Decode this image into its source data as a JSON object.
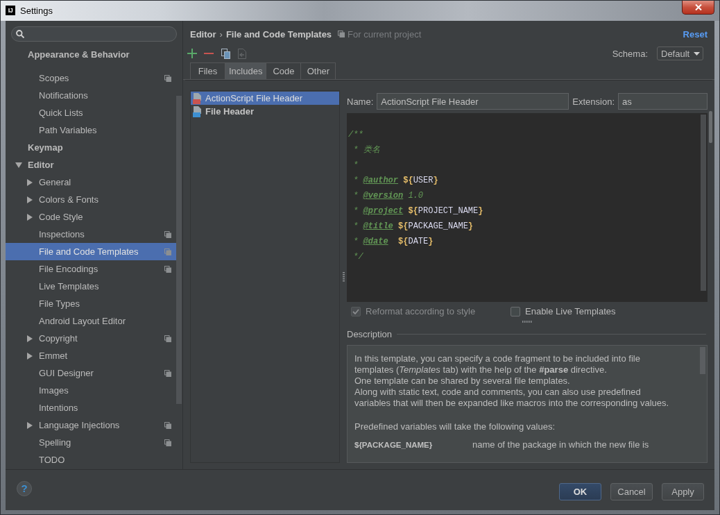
{
  "window": {
    "logo": "IJ",
    "title": "Settings"
  },
  "sidebar": {
    "tree": [
      {
        "label": "Appearance & Behavior",
        "selected": false,
        "per_project": false,
        "children": [
          {
            "label": "Scopes",
            "selected": false,
            "per_project": true
          },
          {
            "label": "Notifications",
            "selected": false,
            "per_project": false
          },
          {
            "label": "Quick Lists",
            "selected": false,
            "per_project": false
          },
          {
            "label": "Path Variables",
            "selected": false,
            "per_project": false
          }
        ]
      },
      {
        "label": "Keymap",
        "selected": false,
        "per_project": false
      },
      {
        "label": "Editor",
        "selected": false,
        "per_project": false,
        "expanded": true,
        "children": [
          {
            "label": "General",
            "selected": false,
            "per_project": false,
            "expanded": false
          },
          {
            "label": "Colors & Fonts",
            "selected": false,
            "per_project": false,
            "expanded": false
          },
          {
            "label": "Code Style",
            "selected": false,
            "per_project": false,
            "expanded": false
          },
          {
            "label": "Inspections",
            "selected": false,
            "per_project": true
          },
          {
            "label": "File and Code Templates",
            "selected": true,
            "per_project": true
          },
          {
            "label": "File Encodings",
            "selected": false,
            "per_project": true
          },
          {
            "label": "Live Templates",
            "selected": false,
            "per_project": false
          },
          {
            "label": "File Types",
            "selected": false,
            "per_project": false
          },
          {
            "label": "Android Layout Editor",
            "selected": false,
            "per_project": false
          },
          {
            "label": "Copyright",
            "selected": false,
            "per_project": true,
            "expanded": false
          },
          {
            "label": "Emmet",
            "selected": false,
            "per_project": false,
            "expanded": false
          },
          {
            "label": "GUI Designer",
            "selected": false,
            "per_project": true
          },
          {
            "label": "Images",
            "selected": false,
            "per_project": false
          },
          {
            "label": "Intentions",
            "selected": false,
            "per_project": false
          },
          {
            "label": "Language Injections",
            "selected": false,
            "per_project": true,
            "expanded": false
          },
          {
            "label": "Spelling",
            "selected": false,
            "per_project": true
          },
          {
            "label": "TODO",
            "selected": false,
            "per_project": false
          }
        ]
      }
    ]
  },
  "header": {
    "breadcrumb": [
      "Editor",
      "File and Code Templates"
    ],
    "separator": "›",
    "scope_note": "For current project",
    "reset": "Reset"
  },
  "toolbar": {
    "buttons": [
      {
        "kind": "add",
        "disabled": false
      },
      {
        "kind": "remove",
        "disabled": false
      },
      {
        "kind": "copy",
        "disabled": false
      },
      {
        "kind": "revert",
        "disabled": true
      }
    ],
    "schema_label": "Schema:",
    "schema_value": "Default"
  },
  "tabs": [
    {
      "label": "Files",
      "selected": false
    },
    {
      "label": "Includes",
      "selected": true
    },
    {
      "label": "Code",
      "selected": false
    },
    {
      "label": "Other",
      "selected": false
    }
  ],
  "templates": [
    {
      "name": "ActionScript File Header",
      "kind": "actionscript",
      "selected": true,
      "modified": false
    },
    {
      "name": "File Header",
      "kind": "java",
      "selected": false,
      "modified": true
    }
  ],
  "editor": {
    "name_label": "Name:",
    "name": "ActionScript File Header",
    "extension_label": "Extension:",
    "extension": "as",
    "code": [
      {
        "tokens": [
          {
            "kind": "comment",
            "text": "/**"
          }
        ]
      },
      {
        "tokens": [
          {
            "kind": "comment",
            "text": " * 类名"
          }
        ]
      },
      {
        "tokens": [
          {
            "kind": "comment",
            "text": " *"
          }
        ]
      },
      {
        "tokens": [
          {
            "kind": "comment",
            "text": " * "
          },
          {
            "kind": "tag",
            "text": "@author"
          },
          {
            "kind": "delim",
            "text": " ${"
          },
          {
            "kind": "var",
            "text": "USER"
          },
          {
            "kind": "delim",
            "text": "}"
          }
        ]
      },
      {
        "tokens": [
          {
            "kind": "comment",
            "text": " * "
          },
          {
            "kind": "tag",
            "text": "@version"
          },
          {
            "kind": "comment",
            "text": " 1.0"
          }
        ]
      },
      {
        "tokens": [
          {
            "kind": "comment",
            "text": " * "
          },
          {
            "kind": "tag",
            "text": "@project"
          },
          {
            "kind": "delim",
            "text": " ${"
          },
          {
            "kind": "var",
            "text": "PROJECT_NAME"
          },
          {
            "kind": "delim",
            "text": "}"
          }
        ]
      },
      {
        "tokens": [
          {
            "kind": "comment",
            "text": " * "
          },
          {
            "kind": "tag",
            "text": "@title"
          },
          {
            "kind": "delim",
            "text": " ${"
          },
          {
            "kind": "var",
            "text": "PACKAGE_NAME"
          },
          {
            "kind": "delim",
            "text": "}"
          }
        ]
      },
      {
        "tokens": [
          {
            "kind": "comment",
            "text": " * "
          },
          {
            "kind": "tag",
            "text": "@date"
          },
          {
            "kind": "delim",
            "text": "  ${"
          },
          {
            "kind": "var",
            "text": "DATE"
          },
          {
            "kind": "delim",
            "text": "}"
          }
        ]
      },
      {
        "tokens": [
          {
            "kind": "comment",
            "text": " */"
          }
        ]
      }
    ],
    "options": [
      {
        "label": "Reformat according to style",
        "checked": true,
        "disabled": true
      },
      {
        "label": "Enable Live Templates",
        "checked": false,
        "disabled": false
      }
    ]
  },
  "description": {
    "title": "Description",
    "paragraphs": [
      "In this template, you can specify a code fragment to be included into file templates (*Templates* tab) with the help of the **#parse** directive.",
      "One template can be shared by several file templates.",
      "Along with static text, code and comments, you can also use predefined variables that will then be expanded like macros into the corresponding values."
    ],
    "intro": "Predefined variables will take the following values:",
    "variables": [
      {
        "name": "${PACKAGE_NAME}",
        "meaning": "name of the package in which the new file is"
      }
    ]
  },
  "footer": {
    "help": "?",
    "buttons": [
      {
        "label": "OK",
        "kind": "ok"
      },
      {
        "label": "Cancel",
        "kind": "cancel"
      },
      {
        "label": "Apply",
        "kind": "apply"
      }
    ]
  }
}
